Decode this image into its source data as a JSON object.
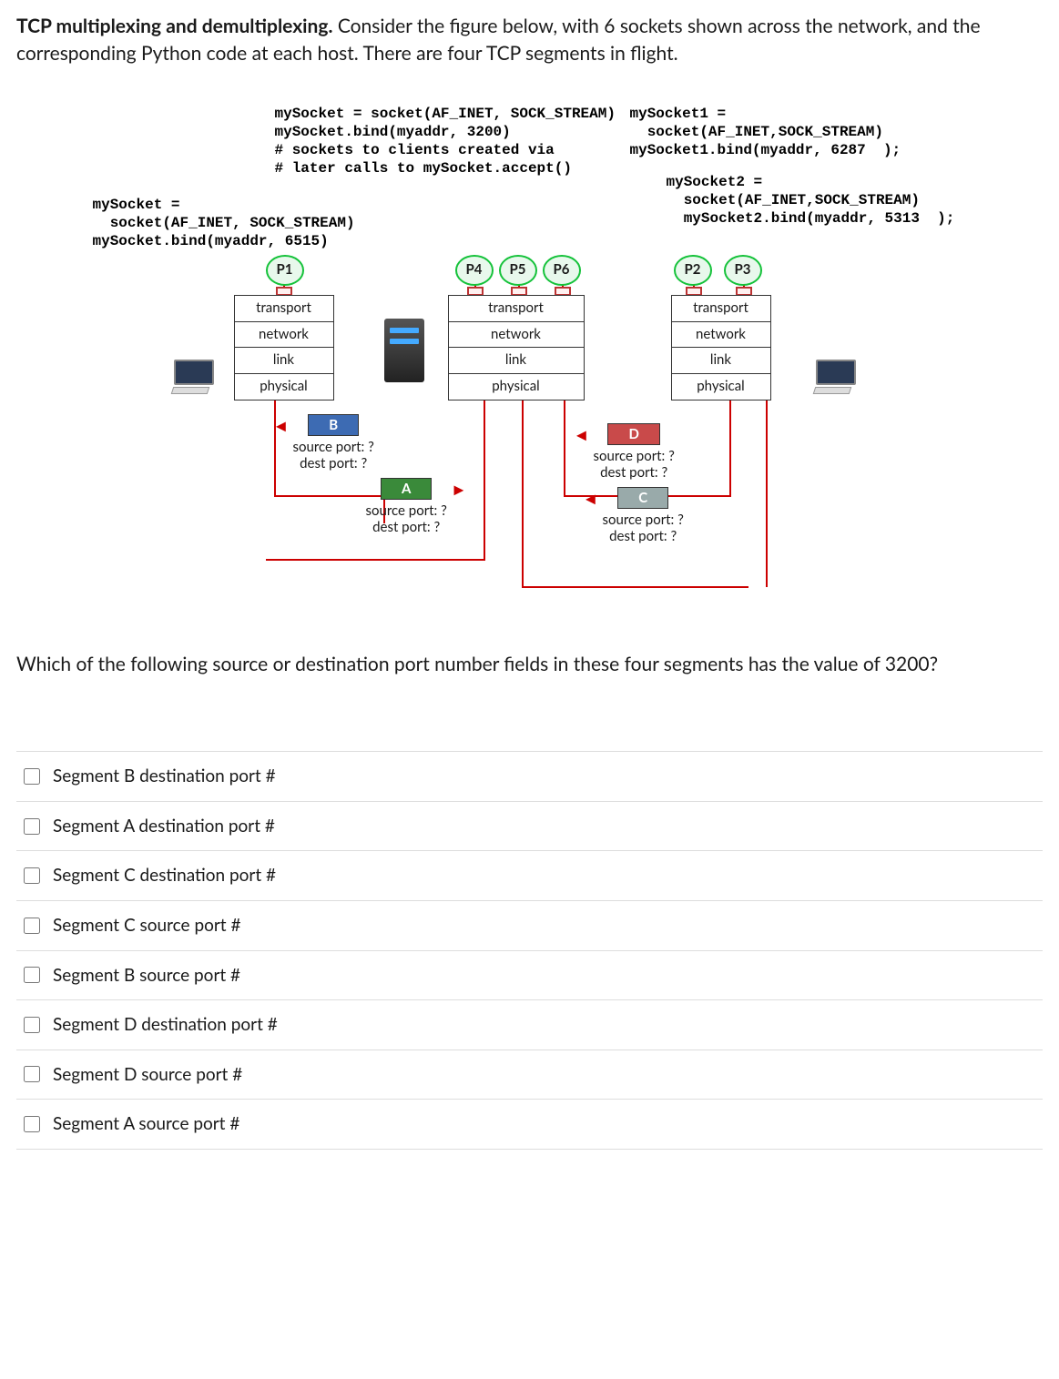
{
  "intro": {
    "bold": "TCP multiplexing and demultiplexing.",
    "rest": " Consider the figure below, with 6 sockets shown across the network, and the corresponding Python code at each host.  There are four TCP segments in flight."
  },
  "code": {
    "left": "mySocket =\n  socket(AF_INET, SOCK_STREAM)\nmySocket.bind(myaddr, 6515)",
    "center": "mySocket = socket(AF_INET, SOCK_STREAM)\nmySocket.bind(myaddr, 3200)\n# sockets to clients created via\n# later calls to mySocket.accept()",
    "right1": "mySocket1 =\n  socket(AF_INET,SOCK_STREAM)\nmySocket1.bind(myaddr, 6287  );",
    "right2": "mySocket2 =\n  socket(AF_INET,SOCK_STREAM)\n  mySocket2.bind(myaddr, 5313  );"
  },
  "processes": {
    "p1": "P1",
    "p2": "P2",
    "p3": "P3",
    "p4": "P4",
    "p5": "P5",
    "p6": "P6"
  },
  "layers": {
    "transport": "transport",
    "network": "network",
    "link": "link",
    "physical": "physical"
  },
  "segments": {
    "A": {
      "label": "A",
      "src": "source port: ?",
      "dst": "dest port: ?"
    },
    "B": {
      "label": "B",
      "src": "source port: ?",
      "dst": "dest port: ?"
    },
    "C": {
      "label": "C",
      "src": "source port: ?",
      "dst": "dest port: ?"
    },
    "D": {
      "label": "D",
      "src": "source port: ?",
      "dst": "dest port: ?"
    }
  },
  "question": "Which of the following source or destination port number fields in these four segments has the value of 3200?",
  "options": [
    "Segment B destination port #",
    "Segment A destination port #",
    "Segment C destination port #",
    "Segment C source port #",
    "Segment B source port #",
    "Segment D destination port #",
    "Segment D source port #",
    "Segment A source port #"
  ],
  "chart_data": {
    "type": "network-diagram",
    "hosts": [
      {
        "role": "client-left",
        "processes": [
          "P1"
        ],
        "socket_code": "mySocket = socket(AF_INET, SOCK_STREAM); mySocket.bind(myaddr, 6515)",
        "bound_port": 6515
      },
      {
        "role": "server-center",
        "processes": [
          "P4",
          "P5",
          "P6"
        ],
        "socket_code": "mySocket = socket(AF_INET, SOCK_STREAM); mySocket.bind(myaddr, 3200); # sockets to clients created via later calls to mySocket.accept()",
        "bound_port": 3200
      },
      {
        "role": "client-right",
        "processes": [
          "P2",
          "P3"
        ],
        "sockets": [
          {
            "name": "mySocket1",
            "port": 6287
          },
          {
            "name": "mySocket2",
            "port": 5313
          }
        ]
      }
    ],
    "layers": [
      "transport",
      "network",
      "link",
      "physical"
    ],
    "segments": [
      {
        "id": "A",
        "direction": "left→center",
        "source_port": "?",
        "dest_port": "?"
      },
      {
        "id": "B",
        "direction": "center→left",
        "source_port": "?",
        "dest_port": "?"
      },
      {
        "id": "C",
        "direction": "center→right",
        "source_port": "?",
        "dest_port": "?"
      },
      {
        "id": "D",
        "direction": "right→center",
        "source_port": "?",
        "dest_port": "?"
      }
    ],
    "question_value": 3200
  }
}
